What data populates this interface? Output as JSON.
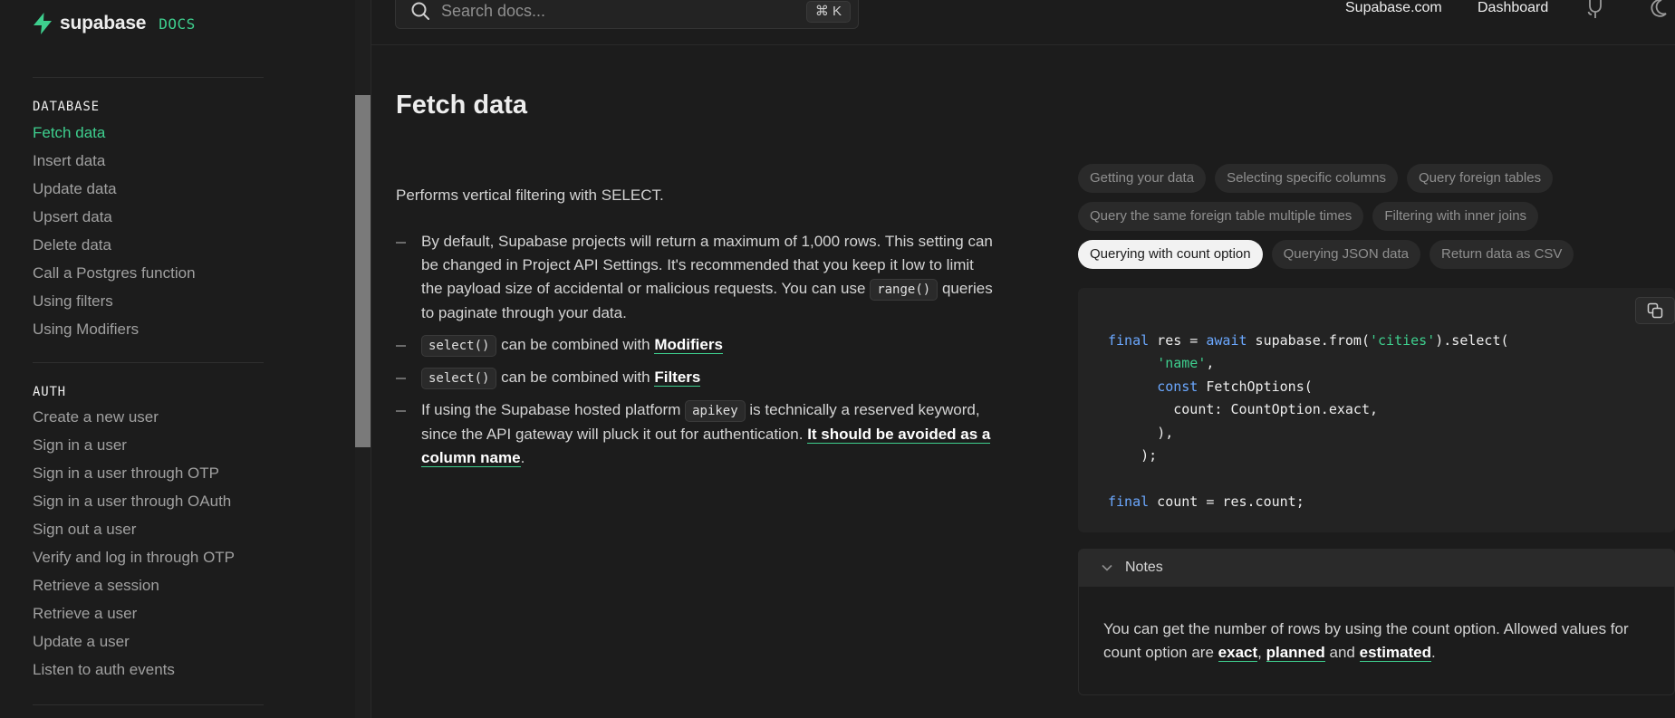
{
  "brand": {
    "name": "supabase",
    "suffix": "DOCS",
    "accent": "#3ecf8e"
  },
  "search": {
    "placeholder": "Search docs...",
    "shortcut": "⌘ K"
  },
  "topnav": {
    "site_link": "Supabase.com",
    "dashboard_link": "Dashboard"
  },
  "sidebar": {
    "database": {
      "title": "DATABASE",
      "items": [
        "Fetch data",
        "Insert data",
        "Update data",
        "Upsert data",
        "Delete data",
        "Call a Postgres function",
        "Using filters",
        "Using Modifiers"
      ],
      "active": "Fetch data"
    },
    "auth": {
      "title": "AUTH",
      "items": [
        "Create a new user",
        "Sign in a user",
        "Sign in a user through OTP",
        "Sign in a user through OAuth",
        "Sign out a user",
        "Verify and log in through OTP",
        "Retrieve a session",
        "Retrieve a user",
        "Update a user",
        "Listen to auth events"
      ]
    }
  },
  "page": {
    "title": "Fetch data",
    "lead": "Performs vertical filtering with SELECT.",
    "bullets": {
      "b1_text1": "By default, Supabase projects will return a maximum of 1,000 rows. This setting can be changed in Project API Settings. It's recommended that you keep it low to limit the payload size of accidental or malicious requests. You can use",
      "b1_code": "range()",
      "b1_text2": "queries to paginate through your data.",
      "b2_code": "select()",
      "b2_text": "can be combined with",
      "b2_link": "Modifiers",
      "b3_code": "select()",
      "b3_text": "can be combined with",
      "b3_link": "Filters",
      "b4_text1": "If using the Supabase hosted platform",
      "b4_code": "apikey",
      "b4_text2": "is technically a reserved keyword, since the API gateway will pluck it out for authentication.",
      "b4_link": "It should be avoided as a column name",
      "b4_end": "."
    }
  },
  "examples": {
    "tabs": [
      "Getting your data",
      "Selecting specific columns",
      "Query foreign tables",
      "Query the same foreign table multiple times",
      "Filtering with inner joins",
      "Querying with count option",
      "Querying JSON data",
      "Return data as CSV"
    ],
    "active": "Querying with count option"
  },
  "code": {
    "l1_kw": "final",
    "l1_a": " res = ",
    "l1_kw2": "await",
    "l1_b": " supabase.from(",
    "l1_str": "'cities'",
    "l1_c": ").select(",
    "l2_str": "'name'",
    "l2_b": ",",
    "l3_kw": "const",
    "l3_b": " FetchOptions(",
    "l4": "count: CountOption.exact,",
    "l5": "),",
    "l6": ");",
    "l8_kw": "final",
    "l8_b": " count = res.count;"
  },
  "notes": {
    "title": "Notes",
    "text1": "You can get the number of rows by using the count option. Allowed values for count option are",
    "link1": "exact",
    "sep1": ",",
    "link2": "planned",
    "and": "and",
    "link3": "estimated",
    "end": "."
  }
}
